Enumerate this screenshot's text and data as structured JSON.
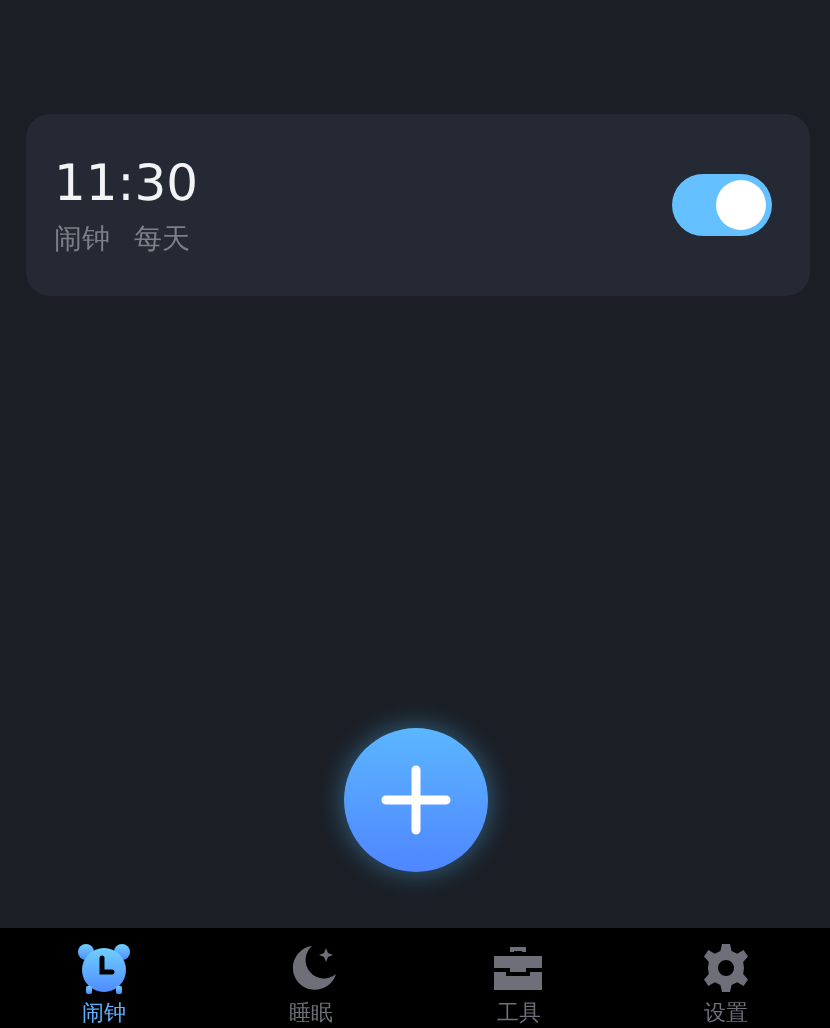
{
  "alarms": [
    {
      "time": "11:30",
      "label": "闹钟",
      "repeat": "每天",
      "on": true
    }
  ],
  "nav": [
    {
      "kind": "alarm",
      "label": "闹钟",
      "selected": true
    },
    {
      "kind": "sleep",
      "label": "睡眠",
      "selected": false
    },
    {
      "kind": "tools",
      "label": "工具",
      "selected": false
    },
    {
      "kind": "settings",
      "label": "设置",
      "selected": false
    }
  ]
}
